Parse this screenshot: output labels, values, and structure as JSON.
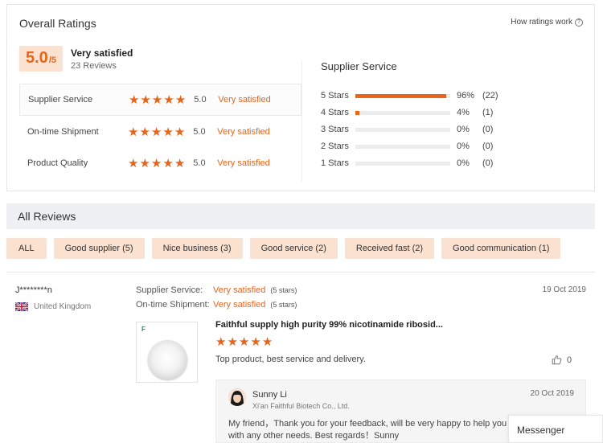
{
  "overall": {
    "title": "Overall Ratings",
    "how_link": "How ratings work",
    "help_icon": "question-circle-icon",
    "score": "5.0",
    "score_max": "/5",
    "label": "Very satisfied",
    "reviews": "23 Reviews"
  },
  "criteria": [
    {
      "label": "Supplier Service",
      "score": "5.0",
      "text": "Very satisfied",
      "stars": 5
    },
    {
      "label": "On-time Shipment",
      "score": "5.0",
      "text": "Very satisfied",
      "stars": 5
    },
    {
      "label": "Product Quality",
      "score": "5.0",
      "text": "Very satisfied",
      "stars": 5
    }
  ],
  "supplier_service": {
    "title": "Supplier Service",
    "bars": [
      {
        "label": "5 Stars",
        "pct": "96%",
        "count": "(22)",
        "fraction": 0.96
      },
      {
        "label": "4 Stars",
        "pct": "4%",
        "count": "(1)",
        "fraction": 0.04
      },
      {
        "label": "3 Stars",
        "pct": "0%",
        "count": "(0)",
        "fraction": 0
      },
      {
        "label": "2 Stars",
        "pct": "0%",
        "count": "(0)",
        "fraction": 0
      },
      {
        "label": "1 Stars",
        "pct": "0%",
        "count": "(0)",
        "fraction": 0
      }
    ]
  },
  "all_reviews": {
    "title": "All Reviews",
    "filters": [
      "ALL",
      "Good supplier (5)",
      "Nice business (3)",
      "Good service (2)",
      "Received fast (2)",
      "Good communication (1)"
    ]
  },
  "review": {
    "reviewer": "J********n",
    "country": "United Kingdom",
    "date": "19 Oct 2019",
    "supplier_service_key": "Supplier Service:",
    "supplier_service_val": "Very satisfied",
    "supplier_service_stars": "(5 stars)",
    "shipment_key": "On-time Shipment:",
    "shipment_val": "Very satisfied",
    "shipment_stars": "(5 stars)",
    "product_title": "Faithful supply high purity 99% nicotinamide ribosid...",
    "rating": 5,
    "text": "Top product, best service and delivery.",
    "likes": "0",
    "thumb_logo": "F"
  },
  "reply": {
    "name": "Sunny Li",
    "company": "Xi'an Faithful Biotech Co., Ltd.",
    "date": "20 Oct 2019",
    "text": "My friend，Thank you for your feedback, will be very happy to help you with any other needs. Best regards！Sunny"
  },
  "messenger": {
    "label": "Messenger"
  },
  "colors": {
    "accent": "#e8641b",
    "chip_bg": "#fbe1d0",
    "header_bg": "#eef0f4"
  }
}
